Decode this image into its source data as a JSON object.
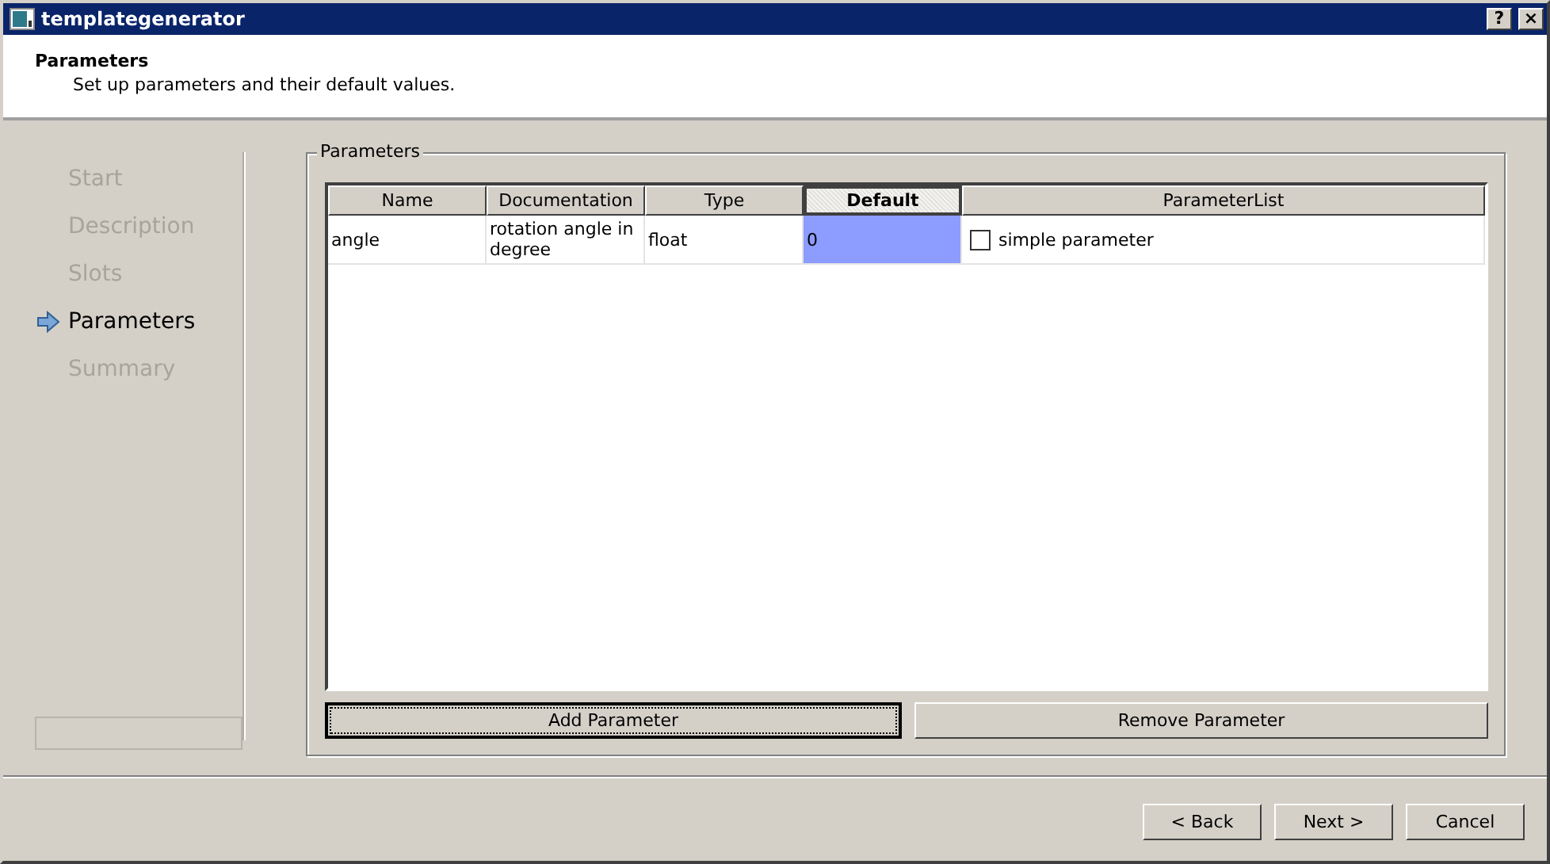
{
  "window": {
    "title": "templategenerator",
    "help_button": "?",
    "close_button": "×"
  },
  "header": {
    "title": "Parameters",
    "subtitle": "Set up parameters and their default values."
  },
  "steps": [
    {
      "label": "Start",
      "selected": false
    },
    {
      "label": "Description",
      "selected": false
    },
    {
      "label": "Slots",
      "selected": false
    },
    {
      "label": "Parameters",
      "selected": true
    },
    {
      "label": "Summary",
      "selected": false
    }
  ],
  "group": {
    "title": "Parameters",
    "table": {
      "columns": [
        {
          "label": "Name",
          "selected": false
        },
        {
          "label": "Documentation",
          "selected": false
        },
        {
          "label": "Type",
          "selected": false
        },
        {
          "label": "Default",
          "selected": true
        },
        {
          "label": "ParameterList",
          "selected": false
        }
      ],
      "rows": [
        {
          "name": "angle",
          "documentation": "rotation angle in degree",
          "type": "float",
          "default": "0",
          "default_selected": true,
          "parameter_list": {
            "label": "simple parameter",
            "checked": false
          }
        }
      ]
    },
    "buttons": [
      {
        "label": "Add Parameter",
        "focused": true
      },
      {
        "label": "Remove Parameter",
        "focused": false
      }
    ]
  },
  "footer_buttons": [
    "< Back",
    "Next >",
    "Cancel"
  ]
}
